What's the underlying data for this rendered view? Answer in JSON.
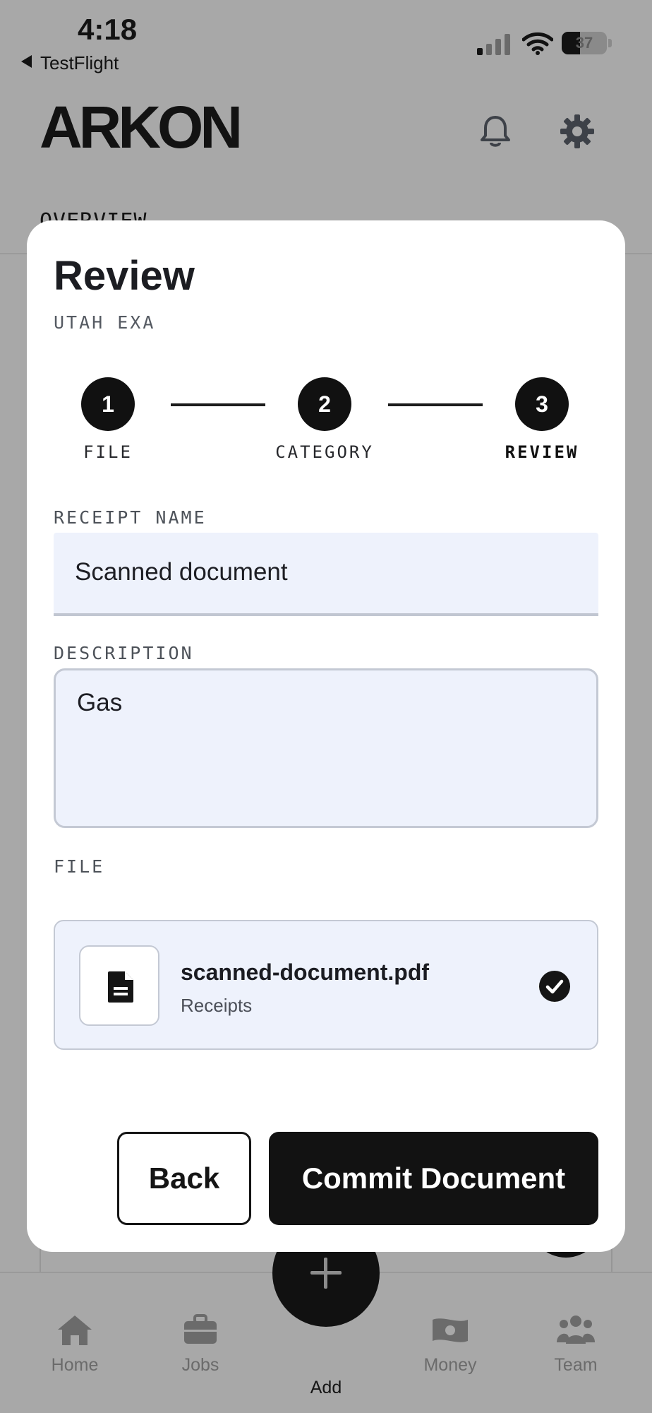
{
  "status_bar": {
    "time": "4:18",
    "back_app": "TestFlight",
    "battery": "37"
  },
  "header": {
    "logo": "ARKON"
  },
  "background": {
    "section_title": "OVERVIEW"
  },
  "modal": {
    "title": "Review",
    "subtitle": "UTAH EXA",
    "steps": [
      {
        "number": "1",
        "label": "FILE"
      },
      {
        "number": "2",
        "label": "CATEGORY"
      },
      {
        "number": "3",
        "label": "REVIEW"
      }
    ],
    "current_step": 3,
    "receipt_name": {
      "label": "RECEIPT NAME",
      "value": "Scanned document"
    },
    "description": {
      "label": "DESCRIPTION",
      "value": "Gas"
    },
    "file": {
      "label": "FILE",
      "name": "scanned-document.pdf",
      "category": "Receipts"
    },
    "buttons": {
      "back": "Back",
      "commit": "Commit Document"
    }
  },
  "tabbar": {
    "items": [
      {
        "label": "Home",
        "icon": "home-icon"
      },
      {
        "label": "Jobs",
        "icon": "briefcase-icon"
      },
      {
        "label": "Add",
        "icon": "plus-icon"
      },
      {
        "label": "Money",
        "icon": "money-icon"
      },
      {
        "label": "Team",
        "icon": "team-icon"
      }
    ],
    "active": "Add"
  }
}
